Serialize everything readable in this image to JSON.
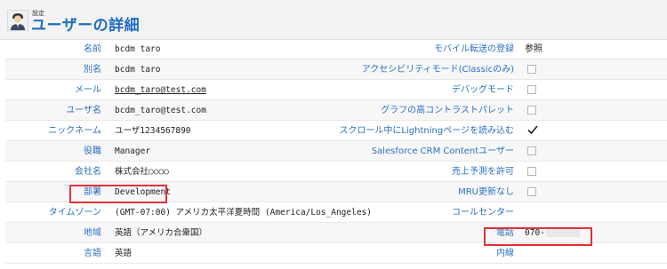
{
  "header": {
    "eyebrow": "設定",
    "title": "ユーザーの詳細"
  },
  "rows": [
    {
      "left_label": "名前",
      "left_value": "bcdm taro",
      "right_label": "モバイル転送の登録",
      "right_value": "参照",
      "right_type": "text"
    },
    {
      "left_label": "別名",
      "left_value": "bcdm taro",
      "right_label": "アクセシビリティモード(Classicのみ)",
      "right_type": "checkbox",
      "checked": false
    },
    {
      "left_label": "メール",
      "left_value": "bcdm_taro@test.com",
      "right_label": "デバッグモード",
      "right_type": "checkbox",
      "checked": false
    },
    {
      "left_label": "ユーザ名",
      "left_value": "bcdm_taro@test.com",
      "right_label": "グラフの高コントラストパレット",
      "right_type": "checkbox",
      "checked": false
    },
    {
      "left_label": "ニックネーム",
      "left_value": "ユーザ1234567890",
      "right_label": "スクロール中にLightningページを読み込む",
      "right_type": "checkbox",
      "checked": true
    },
    {
      "left_label": "役職",
      "left_value": "Manager",
      "right_label": "Salesforce CRM Contentユーザー",
      "right_type": "checkbox",
      "checked": false
    },
    {
      "left_label": "会社名",
      "left_value": "株式会社○○○○",
      "right_label": "売上予測を許可",
      "right_type": "checkbox",
      "checked": false
    },
    {
      "left_label": "部署",
      "left_value": "Development",
      "right_label": "MRU更新なし",
      "right_type": "checkbox",
      "checked": false
    },
    {
      "left_label": "タイムゾーン",
      "left_value": "(GMT-07:00) アメリカ太平洋夏時間 (America/Los_Angeles)",
      "right_label": "コールセンター",
      "right_type": "none"
    },
    {
      "left_label": "地域",
      "left_value": "英語（アメリカ合衆国）",
      "right_label": "電話",
      "right_value": "070-",
      "right_type": "phone"
    },
    {
      "left_label": "言語",
      "left_value": "英語",
      "right_label": "内線",
      "right_type": "none"
    }
  ],
  "colors": {
    "label_blue": "#2a6fc4",
    "title_blue": "#1f6cc5",
    "highlight_red": "#e0313a"
  },
  "icons": {
    "avatar": "user-avatar-icon",
    "check": "checkmark-icon"
  }
}
